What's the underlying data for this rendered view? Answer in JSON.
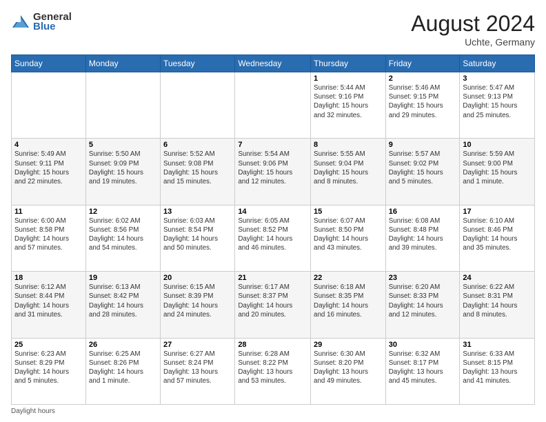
{
  "header": {
    "logo_general": "General",
    "logo_blue": "Blue",
    "month_year": "August 2024",
    "location": "Uchte, Germany"
  },
  "calendar": {
    "days_of_week": [
      "Sunday",
      "Monday",
      "Tuesday",
      "Wednesday",
      "Thursday",
      "Friday",
      "Saturday"
    ],
    "weeks": [
      [
        {
          "day": "",
          "info": ""
        },
        {
          "day": "",
          "info": ""
        },
        {
          "day": "",
          "info": ""
        },
        {
          "day": "",
          "info": ""
        },
        {
          "day": "1",
          "info": "Sunrise: 5:44 AM\nSunset: 9:16 PM\nDaylight: 15 hours\nand 32 minutes."
        },
        {
          "day": "2",
          "info": "Sunrise: 5:46 AM\nSunset: 9:15 PM\nDaylight: 15 hours\nand 29 minutes."
        },
        {
          "day": "3",
          "info": "Sunrise: 5:47 AM\nSunset: 9:13 PM\nDaylight: 15 hours\nand 25 minutes."
        }
      ],
      [
        {
          "day": "4",
          "info": "Sunrise: 5:49 AM\nSunset: 9:11 PM\nDaylight: 15 hours\nand 22 minutes."
        },
        {
          "day": "5",
          "info": "Sunrise: 5:50 AM\nSunset: 9:09 PM\nDaylight: 15 hours\nand 19 minutes."
        },
        {
          "day": "6",
          "info": "Sunrise: 5:52 AM\nSunset: 9:08 PM\nDaylight: 15 hours\nand 15 minutes."
        },
        {
          "day": "7",
          "info": "Sunrise: 5:54 AM\nSunset: 9:06 PM\nDaylight: 15 hours\nand 12 minutes."
        },
        {
          "day": "8",
          "info": "Sunrise: 5:55 AM\nSunset: 9:04 PM\nDaylight: 15 hours\nand 8 minutes."
        },
        {
          "day": "9",
          "info": "Sunrise: 5:57 AM\nSunset: 9:02 PM\nDaylight: 15 hours\nand 5 minutes."
        },
        {
          "day": "10",
          "info": "Sunrise: 5:59 AM\nSunset: 9:00 PM\nDaylight: 15 hours\nand 1 minute."
        }
      ],
      [
        {
          "day": "11",
          "info": "Sunrise: 6:00 AM\nSunset: 8:58 PM\nDaylight: 14 hours\nand 57 minutes."
        },
        {
          "day": "12",
          "info": "Sunrise: 6:02 AM\nSunset: 8:56 PM\nDaylight: 14 hours\nand 54 minutes."
        },
        {
          "day": "13",
          "info": "Sunrise: 6:03 AM\nSunset: 8:54 PM\nDaylight: 14 hours\nand 50 minutes."
        },
        {
          "day": "14",
          "info": "Sunrise: 6:05 AM\nSunset: 8:52 PM\nDaylight: 14 hours\nand 46 minutes."
        },
        {
          "day": "15",
          "info": "Sunrise: 6:07 AM\nSunset: 8:50 PM\nDaylight: 14 hours\nand 43 minutes."
        },
        {
          "day": "16",
          "info": "Sunrise: 6:08 AM\nSunset: 8:48 PM\nDaylight: 14 hours\nand 39 minutes."
        },
        {
          "day": "17",
          "info": "Sunrise: 6:10 AM\nSunset: 8:46 PM\nDaylight: 14 hours\nand 35 minutes."
        }
      ],
      [
        {
          "day": "18",
          "info": "Sunrise: 6:12 AM\nSunset: 8:44 PM\nDaylight: 14 hours\nand 31 minutes."
        },
        {
          "day": "19",
          "info": "Sunrise: 6:13 AM\nSunset: 8:42 PM\nDaylight: 14 hours\nand 28 minutes."
        },
        {
          "day": "20",
          "info": "Sunrise: 6:15 AM\nSunset: 8:39 PM\nDaylight: 14 hours\nand 24 minutes."
        },
        {
          "day": "21",
          "info": "Sunrise: 6:17 AM\nSunset: 8:37 PM\nDaylight: 14 hours\nand 20 minutes."
        },
        {
          "day": "22",
          "info": "Sunrise: 6:18 AM\nSunset: 8:35 PM\nDaylight: 14 hours\nand 16 minutes."
        },
        {
          "day": "23",
          "info": "Sunrise: 6:20 AM\nSunset: 8:33 PM\nDaylight: 14 hours\nand 12 minutes."
        },
        {
          "day": "24",
          "info": "Sunrise: 6:22 AM\nSunset: 8:31 PM\nDaylight: 14 hours\nand 8 minutes."
        }
      ],
      [
        {
          "day": "25",
          "info": "Sunrise: 6:23 AM\nSunset: 8:29 PM\nDaylight: 14 hours\nand 5 minutes."
        },
        {
          "day": "26",
          "info": "Sunrise: 6:25 AM\nSunset: 8:26 PM\nDaylight: 14 hours\nand 1 minute."
        },
        {
          "day": "27",
          "info": "Sunrise: 6:27 AM\nSunset: 8:24 PM\nDaylight: 13 hours\nand 57 minutes."
        },
        {
          "day": "28",
          "info": "Sunrise: 6:28 AM\nSunset: 8:22 PM\nDaylight: 13 hours\nand 53 minutes."
        },
        {
          "day": "29",
          "info": "Sunrise: 6:30 AM\nSunset: 8:20 PM\nDaylight: 13 hours\nand 49 minutes."
        },
        {
          "day": "30",
          "info": "Sunrise: 6:32 AM\nSunset: 8:17 PM\nDaylight: 13 hours\nand 45 minutes."
        },
        {
          "day": "31",
          "info": "Sunrise: 6:33 AM\nSunset: 8:15 PM\nDaylight: 13 hours\nand 41 minutes."
        }
      ]
    ]
  },
  "footer": {
    "daylight_label": "Daylight hours"
  }
}
